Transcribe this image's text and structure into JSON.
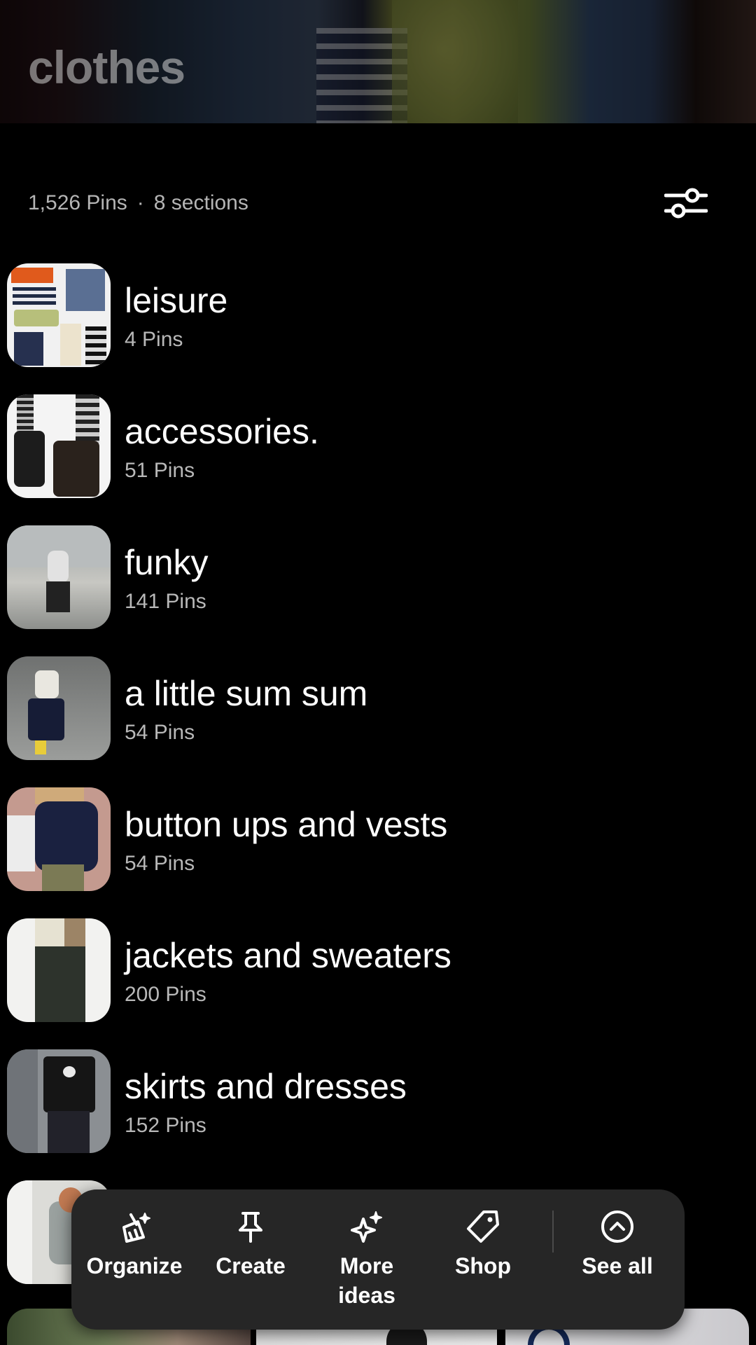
{
  "board": {
    "title": "clothes",
    "pins_count": "1,526 Pins",
    "separator": "·",
    "sections_count": "8 sections"
  },
  "sections": [
    {
      "name": "leisure",
      "count": "4 Pins"
    },
    {
      "name": "accessories.",
      "count": "51 Pins"
    },
    {
      "name": "funky",
      "count": "141 Pins"
    },
    {
      "name": "a little sum sum",
      "count": "54 Pins"
    },
    {
      "name": "button ups and vests",
      "count": "54 Pins"
    },
    {
      "name": "jackets and sweaters",
      "count": "200 Pins"
    },
    {
      "name": "skirts and dresses",
      "count": "152 Pins"
    }
  ],
  "action_bar": {
    "organize": {
      "label": "Organize",
      "icon": "broom-icon"
    },
    "create": {
      "label": "Create",
      "icon": "pushpin-icon"
    },
    "more_ideas": {
      "label": "More\nideas",
      "icon": "sparkle-icon"
    },
    "shop": {
      "label": "Shop",
      "icon": "tag-icon"
    },
    "see_all": {
      "label": "See all",
      "icon": "chevron-up-circle-icon"
    }
  },
  "colors": {
    "background": "#000000",
    "action_bar": "#262626",
    "secondary_text": "#b5b5b5"
  }
}
